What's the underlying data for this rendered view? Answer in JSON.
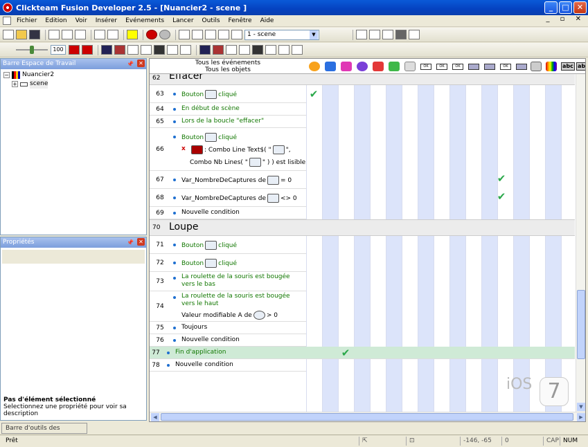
{
  "window": {
    "title": "Clickteam Fusion Developer 2.5 - [Nuancier2 - scene ]",
    "min": "_",
    "max": "□",
    "close": "✕"
  },
  "menu": [
    "Fichier",
    "Edition",
    "Voir",
    "Insérer",
    "Evénements",
    "Lancer",
    "Outils",
    "Fenêtre",
    "Aide"
  ],
  "mdi_controls": "_ ▫ ✕",
  "toolbar": {
    "scene_select": "1 - scene",
    "zoom": "100"
  },
  "workspace": {
    "title": "Barre Espace de Travail",
    "pin": "📌",
    "close": "✕",
    "app": "Nuancier2",
    "frame": "scene"
  },
  "properties": {
    "title": "Propriétés",
    "pin": "📌",
    "close": "✕",
    "none_title": "Pas d'élément sélectionné",
    "none_desc": "Selectionnez une propriété pour voir sa description"
  },
  "library_tab": "Barre d'outils des librairies",
  "status": {
    "ready": "Prêt",
    "coords": "-146, -65",
    "count": "0",
    "cap": "CAP",
    "num": "NUM"
  },
  "editor": {
    "header_line1": "Tous les événements",
    "header_line2": "Tous les objets",
    "section_effacer": {
      "num": "62",
      "name": "Effacer"
    },
    "section_loupe": {
      "num": "70",
      "name": "Loupe"
    },
    "rows": {
      "r63": {
        "num": "63",
        "pre": "Bouton",
        "post": "cliqué"
      },
      "r64": {
        "num": "64",
        "text": "En début de scène"
      },
      "r65": {
        "num": "65",
        "text": "Lors de la boucle \"effacer\""
      },
      "r66": {
        "num": "66",
        "c1pre": "Bouton",
        "c1post": "cliqué",
        "x": "x",
        "act1": ": Combo Line Text$( \"",
        "act2": "\",",
        "act3": "Combo Nb Lines( \"",
        "act4": "\" ) ) est lisible"
      },
      "r67": {
        "num": "67",
        "pre": "Var_NombreDeCaptures de",
        "post": "= 0"
      },
      "r68": {
        "num": "68",
        "pre": "Var_NombreDeCaptures de",
        "post": "<> 0"
      },
      "r69": {
        "num": "69",
        "text": "Nouvelle condition"
      },
      "r71": {
        "num": "71",
        "pre": "Bouton",
        "post": "cliqué"
      },
      "r72": {
        "num": "72",
        "pre": "Bouton",
        "post": "cliqué"
      },
      "r73": {
        "num": "73",
        "text": "La roulette de la souris est bougée vers le bas"
      },
      "r74": {
        "num": "74",
        "text": "La roulette de la souris est bougée vers le haut",
        "c2pre": "Valeur modifiable A de",
        "c2post": "> 0"
      },
      "r75": {
        "num": "75",
        "text": "Toujours"
      },
      "r76": {
        "num": "76",
        "text": "Nouvelle condition"
      },
      "r77": {
        "num": "77",
        "text": "Fin d'application"
      },
      "r78": {
        "num": "78",
        "text": "Nouvelle condition"
      }
    },
    "check": "✔",
    "ios_text": "iOS",
    "ios_num": "7",
    "abc": "abc",
    "ok": "OK"
  }
}
